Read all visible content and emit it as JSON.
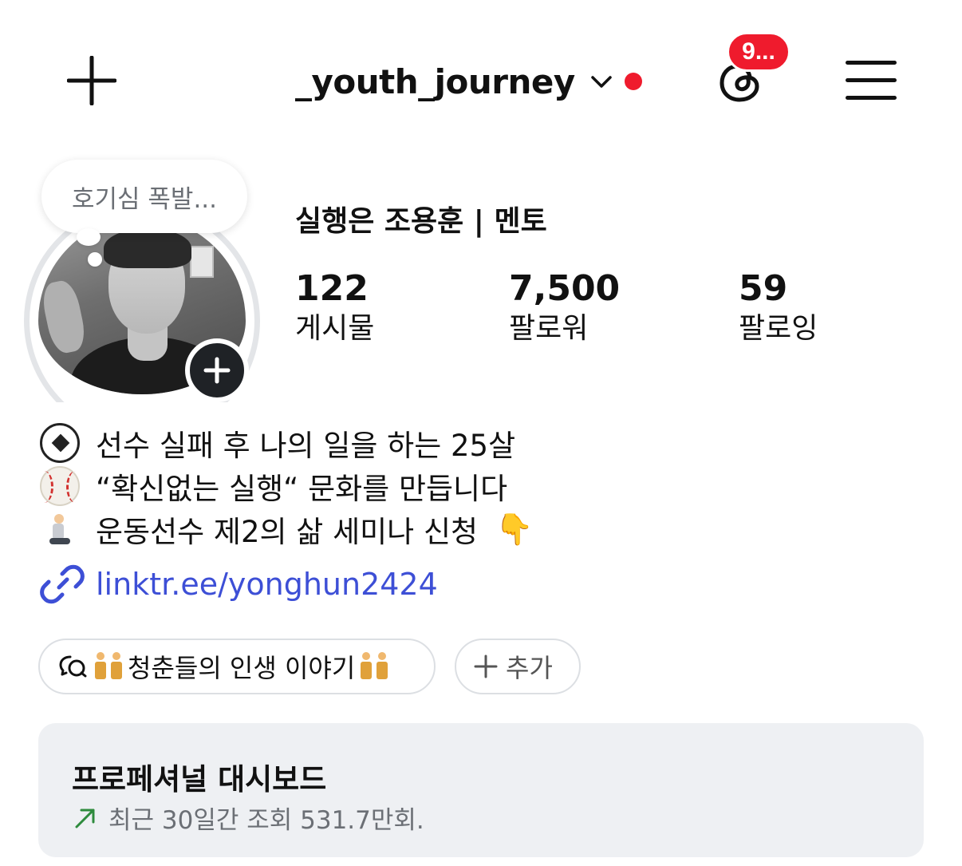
{
  "header": {
    "username": "_youth_journey",
    "threads_badge": "9...",
    "accent_color": "#ef1b2d"
  },
  "profile": {
    "note": "호기심 폭발...",
    "display_name": "실행은 조용훈 | 멘토",
    "stats": [
      {
        "value": "122",
        "label": "게시물"
      },
      {
        "value": "7,500",
        "label": "팔로워"
      },
      {
        "value": "59",
        "label": "팔로잉"
      }
    ]
  },
  "bio": {
    "lines": [
      {
        "icon": "soccer-ball-icon",
        "text": "선수 실패 후 나의 일을 하는 25살"
      },
      {
        "icon": "baseball-icon",
        "text": "“확신없는 실행“ 문화를 만듭니다"
      },
      {
        "icon": "kneeling-person-icon",
        "text": "운동선수 제2의 삶 세미나 신청"
      }
    ],
    "pointing_emoji": "👇",
    "link": "linktr.ee/yonghun2424",
    "link_color": "#3d4fd6"
  },
  "chips": {
    "channel_label": "청춘들의 인생 이야기",
    "add_label": "추가"
  },
  "dashboard": {
    "title": "프로페셔널 대시보드",
    "subtitle": "최근 30일간 조회 531.7만회."
  }
}
